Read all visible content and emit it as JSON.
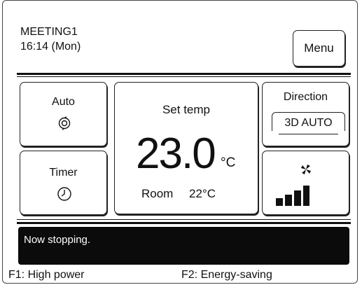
{
  "header": {
    "room_name": "MEETING1",
    "clock": "16:14 (Mon)",
    "menu_label": "Menu"
  },
  "mode": {
    "label": "Auto",
    "icon": "auto-mode-icon"
  },
  "timer": {
    "label": "Timer",
    "icon": "clock-icon"
  },
  "temperature": {
    "set_label": "Set temp",
    "set_value": "23.0",
    "unit": "°C",
    "room_label": "Room",
    "room_value": "22°C"
  },
  "direction": {
    "label": "Direction",
    "value": "3D AUTO"
  },
  "fan": {
    "icon": "fan-icon",
    "level_icon": "fan-speed-bars-icon",
    "level": "4 of 4"
  },
  "status": {
    "message": "Now stopping."
  },
  "function_keys": {
    "f1": "F1: High power",
    "f2": "F2: Energy-saving"
  }
}
